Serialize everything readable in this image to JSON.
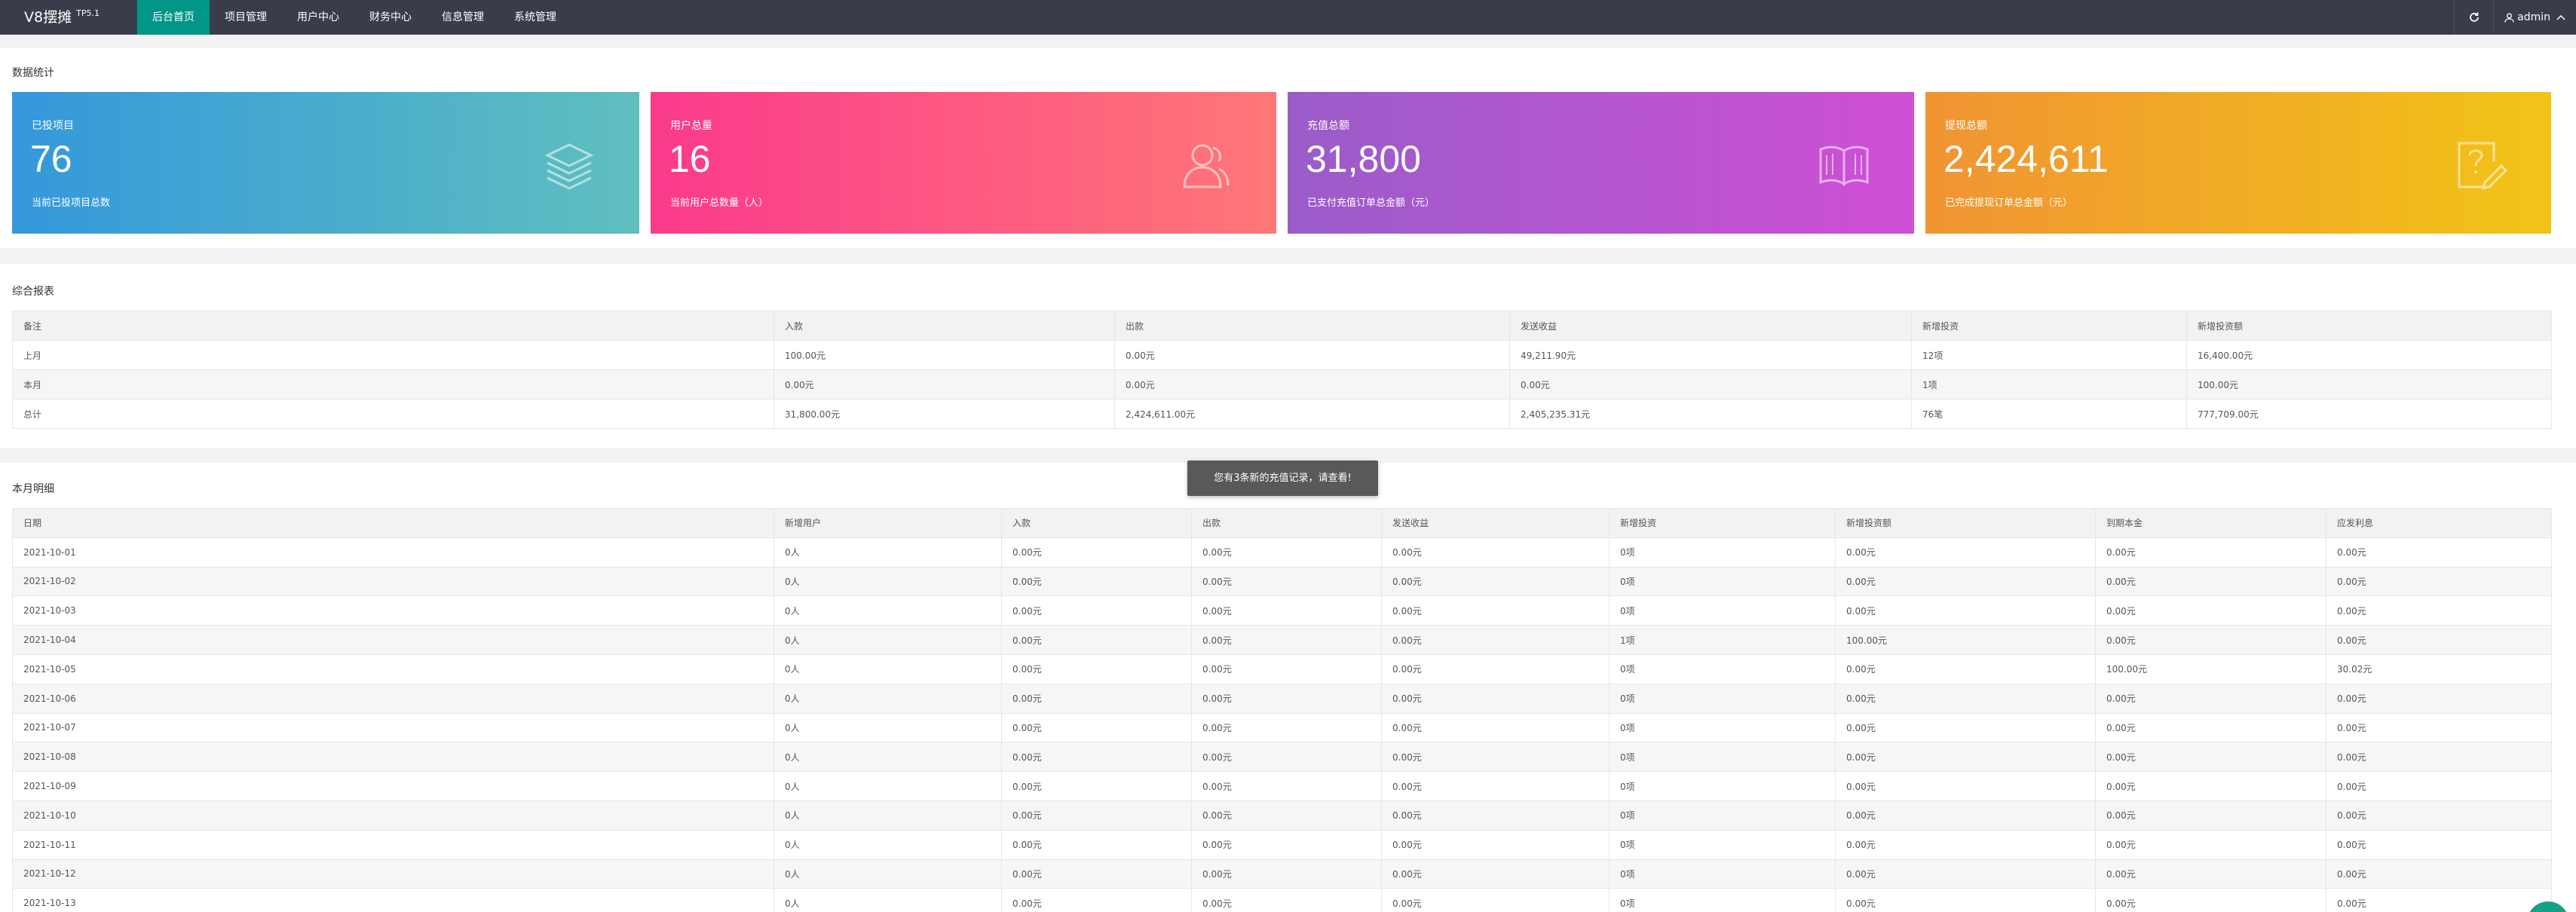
{
  "header": {
    "logo": "V8摆摊",
    "version": "TP5.1",
    "nav": [
      "后台首页",
      "项目管理",
      "用户中心",
      "财务中心",
      "信息管理",
      "系统管理"
    ],
    "user": "admin"
  },
  "stats": {
    "title": "数据统计",
    "cards": [
      {
        "label": "已投项目",
        "value": "76",
        "desc": "当前已投项目总数",
        "icon": "layers-icon",
        "colors": [
          "#3498db",
          "#5fbfbf"
        ]
      },
      {
        "label": "用户总量",
        "value": "16",
        "desc": "当前用户总数量（人）",
        "icon": "users-icon",
        "colors": [
          "#fb3a8c",
          "#ff7777"
        ]
      },
      {
        "label": "充值总额",
        "value": "31,800",
        "desc": "已支付充值订单总金额（元）",
        "icon": "book-icon",
        "colors": [
          "#9a5cc9",
          "#cf4fd6"
        ]
      },
      {
        "label": "提现总额",
        "value": "2,424,611",
        "desc": "已完成提现订单总金额（元）",
        "icon": "edit-icon",
        "colors": [
          "#f09433",
          "#f2c417"
        ]
      }
    ]
  },
  "report": {
    "title": "综合报表",
    "headers": [
      "备注",
      "入款",
      "出款",
      "发送收益",
      "新增投资",
      "新增投资额"
    ],
    "rows": [
      [
        "上月",
        "100.00元",
        "0.00元",
        "49,211.90元",
        "12项",
        "16,400.00元"
      ],
      [
        "本月",
        "0.00元",
        "0.00元",
        "0.00元",
        "1项",
        "100.00元"
      ],
      [
        "总计",
        "31,800.00元",
        "2,424,611.00元",
        "2,405,235.31元",
        "76笔",
        "777,709.00元"
      ]
    ]
  },
  "monthly": {
    "title": "本月明细",
    "headers": [
      "日期",
      "新增用户",
      "入款",
      "出款",
      "发送收益",
      "新增投资",
      "新增投资额",
      "到期本金",
      "应发利息"
    ],
    "rows": [
      [
        "2021-10-01",
        "0人",
        "0.00元",
        "0.00元",
        "0.00元",
        "0项",
        "0.00元",
        "0.00元",
        "0.00元"
      ],
      [
        "2021-10-02",
        "0人",
        "0.00元",
        "0.00元",
        "0.00元",
        "0项",
        "0.00元",
        "0.00元",
        "0.00元"
      ],
      [
        "2021-10-03",
        "0人",
        "0.00元",
        "0.00元",
        "0.00元",
        "0项",
        "0.00元",
        "0.00元",
        "0.00元"
      ],
      [
        "2021-10-04",
        "0人",
        "0.00元",
        "0.00元",
        "0.00元",
        "1项",
        "100.00元",
        "0.00元",
        "0.00元"
      ],
      [
        "2021-10-05",
        "0人",
        "0.00元",
        "0.00元",
        "0.00元",
        "0项",
        "0.00元",
        "100.00元",
        "30.02元"
      ],
      [
        "2021-10-06",
        "0人",
        "0.00元",
        "0.00元",
        "0.00元",
        "0项",
        "0.00元",
        "0.00元",
        "0.00元"
      ],
      [
        "2021-10-07",
        "0人",
        "0.00元",
        "0.00元",
        "0.00元",
        "0项",
        "0.00元",
        "0.00元",
        "0.00元"
      ],
      [
        "2021-10-08",
        "0人",
        "0.00元",
        "0.00元",
        "0.00元",
        "0项",
        "0.00元",
        "0.00元",
        "0.00元"
      ],
      [
        "2021-10-09",
        "0人",
        "0.00元",
        "0.00元",
        "0.00元",
        "0项",
        "0.00元",
        "0.00元",
        "0.00元"
      ],
      [
        "2021-10-10",
        "0人",
        "0.00元",
        "0.00元",
        "0.00元",
        "0项",
        "0.00元",
        "0.00元",
        "0.00元"
      ],
      [
        "2021-10-11",
        "0人",
        "0.00元",
        "0.00元",
        "0.00元",
        "0项",
        "0.00元",
        "0.00元",
        "0.00元"
      ],
      [
        "2021-10-12",
        "0人",
        "0.00元",
        "0.00元",
        "0.00元",
        "0项",
        "0.00元",
        "0.00元",
        "0.00元"
      ],
      [
        "2021-10-13",
        "0人",
        "0.00元",
        "0.00元",
        "0.00元",
        "0项",
        "0.00元",
        "0.00元",
        "0.00元"
      ]
    ]
  },
  "toast": "您有3条新的充值记录，请查看!"
}
